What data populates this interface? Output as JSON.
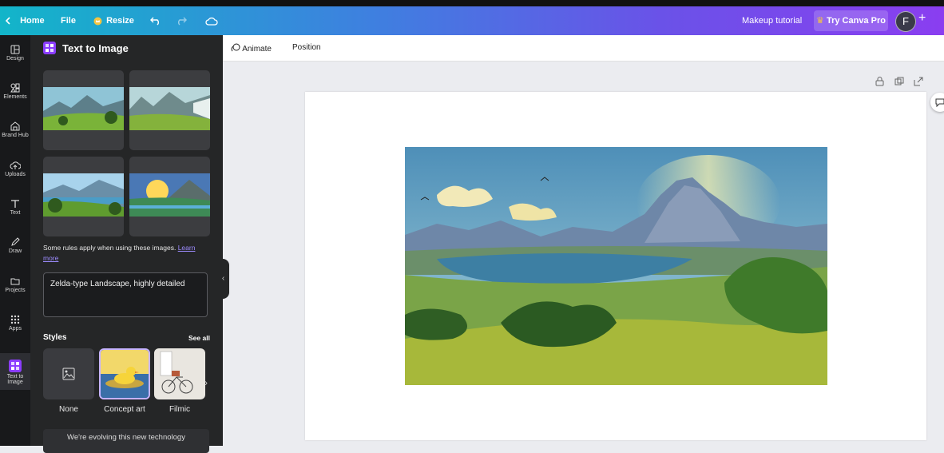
{
  "topbar": {
    "home": "Home",
    "file": "File",
    "resize": "Resize",
    "doc_title": "Makeup tutorial",
    "try_pro": "Try Canva Pro",
    "avatar_initial": "F"
  },
  "rail": [
    {
      "label": "Design",
      "icon": "design-icon"
    },
    {
      "label": "Elements",
      "icon": "elements-icon"
    },
    {
      "label": "Brand Hub",
      "icon": "brand-hub-icon"
    },
    {
      "label": "Uploads",
      "icon": "upload-cloud-icon"
    },
    {
      "label": "Text",
      "icon": "text-icon"
    },
    {
      "label": "Draw",
      "icon": "pen-icon"
    },
    {
      "label": "Projects",
      "icon": "folder-icon"
    },
    {
      "label": "Apps",
      "icon": "apps-grid-icon"
    },
    {
      "label": "Text to Image",
      "icon": "text-to-image-icon"
    }
  ],
  "panel": {
    "title": "Text to Image",
    "rules_text": "Some rules apply when using these images.",
    "learn_more": "Learn more",
    "prompt": "Zelda-type Landscape, highly detailed",
    "styles_heading": "Styles",
    "see_all": "See all",
    "styles": [
      "None",
      "Concept art",
      "Filmic"
    ],
    "evolving": "We're evolving this new technology"
  },
  "toolbar": {
    "animate": "Animate",
    "position": "Position"
  },
  "colors": {
    "accent_purple": "#8b3dff",
    "panel_bg": "#252627",
    "rail_bg": "#18191b"
  }
}
